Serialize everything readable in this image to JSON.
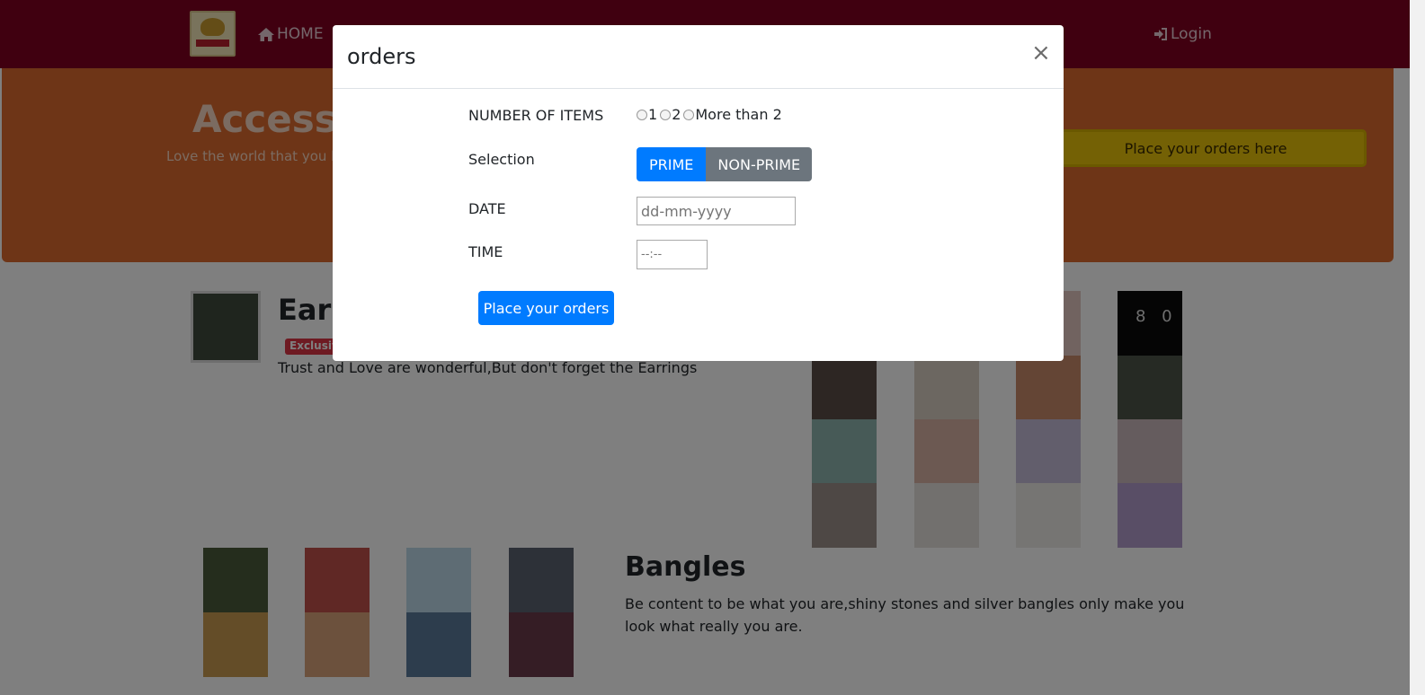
{
  "navbar": {
    "home_label": "HOME",
    "login_label": "Login",
    "home_icon": "home-icon",
    "login_icon": "sign-in-icon",
    "color": "#800020"
  },
  "hero": {
    "title": "Accessor",
    "subtitle": "Love the world that you li",
    "cta_label": "Place your orders here",
    "color": "#dc6a2e"
  },
  "earrings": {
    "title": "Earri",
    "badge": "Exclusive",
    "text": "Trust and Love are wonderful,But don't forget the Earrings",
    "tile_caption": "8 0"
  },
  "bangles": {
    "title": "Bangles",
    "text": "Be content to be what you are,shiny stones and silver bangles only make you look what really you are."
  },
  "modal": {
    "title": "orders",
    "close_label": "×",
    "items_label": "NUMBER OF ITEMS",
    "items_options": [
      "1",
      "2",
      "More than 2"
    ],
    "selection_label": "Selection",
    "selection_options": [
      "PRIME",
      "NON-PRIME"
    ],
    "selection_active": "PRIME",
    "date_label": "DATE",
    "date_placeholder": "dd-mm-yyyy",
    "time_label": "TIME",
    "time_placeholder": "--:--",
    "submit_label": "Place your orders",
    "primary_color": "#007bff",
    "secondary_color": "#6c757d"
  }
}
